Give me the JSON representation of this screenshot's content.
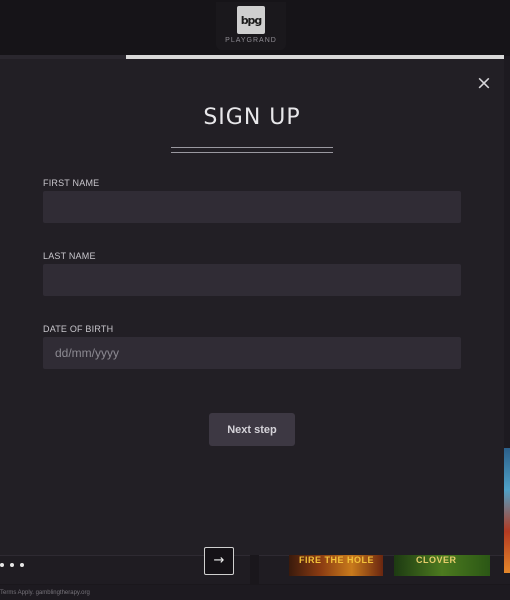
{
  "brand": {
    "logo_mark": "bpg",
    "name": "PLAYGRAND"
  },
  "progress": {
    "step_fraction": 0.25
  },
  "modal": {
    "close_symbol": "×",
    "title": "SIGN UP",
    "fields": [
      {
        "label": "FIRST NAME",
        "value": "",
        "placeholder": ""
      },
      {
        "label": "LAST NAME",
        "value": "",
        "placeholder": ""
      },
      {
        "label": "DATE OF BIRTH",
        "value": "",
        "placeholder": "dd/mm/yyyy"
      }
    ],
    "next_label": "Next step"
  },
  "background": {
    "arrow_symbol": "→",
    "game_1_label": "FIRE THE HOLE",
    "game_2_label": "CLOVER",
    "terms": "Terms Apply. gamblingtherapy.org"
  },
  "colors": {
    "accent": "#3d3843",
    "modal_bg": "#221f25",
    "field_bg": "#302c35"
  }
}
